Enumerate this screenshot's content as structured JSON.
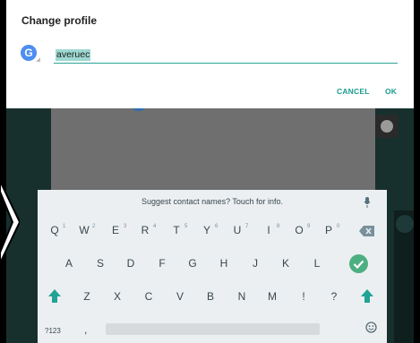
{
  "dialog": {
    "title": "Change profile",
    "account_letter": "G",
    "name_value": "averuec",
    "cancel_label": "CANCEL",
    "ok_label": "OK"
  },
  "keyboard": {
    "suggestion": "Suggest contact names? Touch for info.",
    "row1": [
      {
        "key": "Q",
        "hint": "1"
      },
      {
        "key": "W",
        "hint": "2"
      },
      {
        "key": "E",
        "hint": "3"
      },
      {
        "key": "R",
        "hint": "4"
      },
      {
        "key": "T",
        "hint": "5"
      },
      {
        "key": "Y",
        "hint": "6"
      },
      {
        "key": "U",
        "hint": "7"
      },
      {
        "key": "I",
        "hint": "8"
      },
      {
        "key": "O",
        "hint": "9"
      },
      {
        "key": "P",
        "hint": "0"
      }
    ],
    "row2": [
      "A",
      "S",
      "D",
      "F",
      "G",
      "H",
      "J",
      "K",
      "L"
    ],
    "row3": [
      "Z",
      "X",
      "C",
      "V",
      "B",
      "N",
      "M",
      "!",
      "?"
    ],
    "row4": {
      "symbols": "?123",
      "comma": ","
    },
    "colors": {
      "accent": "#1a9b90",
      "enter": "#4caf82",
      "shift": "#20a395"
    }
  }
}
